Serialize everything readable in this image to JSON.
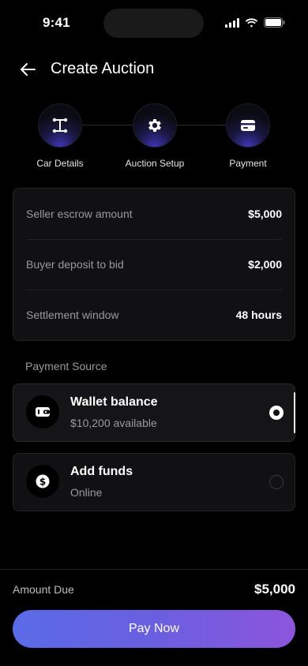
{
  "status_bar": {
    "time": "9:41"
  },
  "header": {
    "title": "Create Auction"
  },
  "steps": [
    {
      "label": "Car Details",
      "icon": "car-details-icon"
    },
    {
      "label": "Auction Setup",
      "icon": "gear-icon"
    },
    {
      "label": "Payment",
      "icon": "card-icon"
    }
  ],
  "summary": {
    "rows": [
      {
        "label": "Seller escrow amount",
        "value": "$5,000"
      },
      {
        "label": "Buyer deposit to bid",
        "value": "$2,000"
      },
      {
        "label": "Settlement window",
        "value": "48 hours"
      }
    ]
  },
  "payment_source": {
    "label": "Payment Source",
    "options": [
      {
        "name": "Wallet balance",
        "sub": "$10,200 available",
        "icon": "wallet-icon",
        "selected": true
      },
      {
        "name": "Add funds",
        "sub": "Online",
        "icon": "dollar-icon",
        "selected": false
      }
    ]
  },
  "footer": {
    "due_label": "Amount Due",
    "due_value": "$5,000",
    "button": "Pay Now"
  },
  "colors": {
    "accent_start": "#5a6be6",
    "accent_end": "#8c55dc",
    "background": "#000000"
  }
}
